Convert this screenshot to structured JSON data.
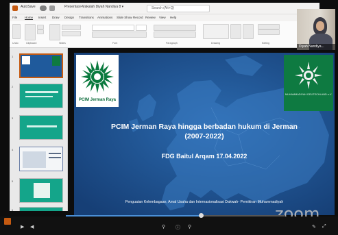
{
  "window": {
    "title": "Presentasi-Makalah Diyah Nandiya 8 ▾",
    "autosave_label": "AutoSave",
    "search_placeholder": "Search (Alt+Q)"
  },
  "menu": [
    "File",
    "Home",
    "Insert",
    "Draw",
    "Design",
    "Transitions",
    "Animations",
    "Slide Show",
    "Record",
    "Review",
    "View",
    "Help"
  ],
  "ribbon_groups": [
    "Undo",
    "Clipboard",
    "Slides",
    "Font",
    "Paragraph",
    "Drawing",
    "Editing"
  ],
  "participant": {
    "name": "Diyah Nandiya..."
  },
  "slides_panel": {
    "numbers": [
      "1",
      "2",
      "3",
      "4",
      "5",
      "6"
    ]
  },
  "slide": {
    "logo_left_caption": "PCIM Jerman Raya",
    "logo_right_caption": "MUHAMMADIYAH DEUTSCHLAND e.V.",
    "title_line1": "PCIM Jerman Raya hingga  berbadan hukum di Jerman",
    "title_line2": "(2007-2022)",
    "subtitle": "FDG Baitul Arqam 17.04.2022",
    "footer": "Penguatan Kelembagaan, Amal Usaha dan Internasionalisasi Dakwah- Pemikiran Muhammadiyah"
  },
  "watermark": "zoom",
  "playback": {
    "progress": 0.62
  },
  "colors": {
    "slide_bg": "#1a4f8f",
    "logo_green": "#0e7a41",
    "accent": "#c55a11"
  }
}
